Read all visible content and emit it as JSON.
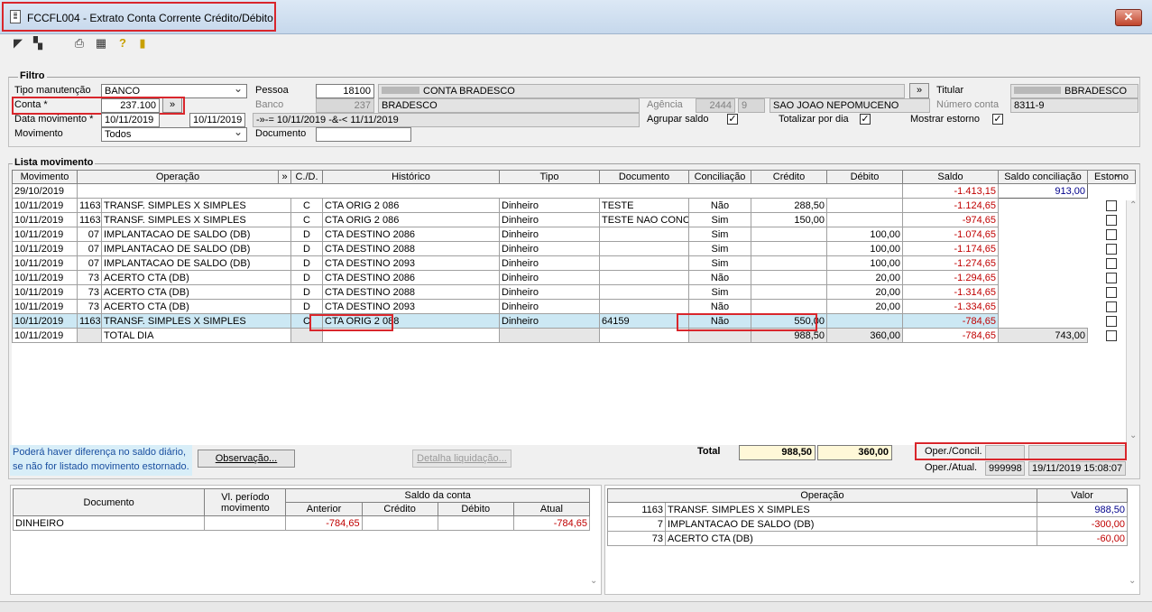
{
  "window": {
    "title": "FCCFL004 - Extrato Conta Corrente Crédito/Débito",
    "close": "✕"
  },
  "toolbar": {
    "icons": [
      "back-icon",
      "forward-icon",
      "print-icon",
      "grid-icon",
      "help-icon",
      "exit-icon"
    ]
  },
  "filtro": {
    "title": "Filtro",
    "tipo_manutencao_label": "Tipo manutenção",
    "tipo_manutencao": "BANCO",
    "conta_label": "Conta *",
    "conta": "237.100",
    "conta_btn": "»",
    "data_mov_label": "Data movimento *",
    "data_ini": "10/11/2019",
    "data_fim": "10/11/2019",
    "movimento_label": "Movimento",
    "movimento": "Todos",
    "pessoa_label": "Pessoa",
    "pessoa_code": "18100",
    "pessoa_name": "CONTA BRADESCO",
    "pessoa_btn": "»",
    "banco_label": "Banco",
    "banco_code": "237",
    "banco_name": "BRADESCO",
    "expr": "-»-= 10/11/2019 -&-< 11/11/2019",
    "documento_label": "Documento",
    "documento": "",
    "titular_label": "Titular",
    "titular": "BBRADESCO",
    "agencia_label": "Agência",
    "agencia": "2444",
    "agencia_dv": "9",
    "agencia_name": "SAO JOAO NEPOMUCENO",
    "numero_conta_label": "Número conta",
    "numero_conta": "8311-9",
    "agrupar_label": "Agrupar saldo",
    "totalizar_label": "Totalizar por dia",
    "mostrar_label": "Mostrar estorno",
    "check_mark": "✓"
  },
  "lista": {
    "title": "Lista movimento",
    "headers": {
      "movimento": "Movimento",
      "operacao": "Operação",
      "more": "»",
      "cd": "C./D.",
      "historico": "Histórico",
      "tipo": "Tipo",
      "documento": "Documento",
      "conciliacao": "Conciliação",
      "credito": "Crédito",
      "debito": "Débito",
      "saldo": "Saldo",
      "saldo_conc": "Saldo conciliação",
      "estorno": "Estorno"
    },
    "first_row": {
      "date": "29/10/2019",
      "saldo": "-1.413,15",
      "saldo_conc": "913,00"
    },
    "rows": [
      {
        "date": "10/11/2019",
        "op_code": "1163",
        "op": "TRANSF. SIMPLES X SIMPLES",
        "cd": "C",
        "hist": "CTA ORIG  2 086",
        "tipo": "Dinheiro",
        "doc": "TESTE",
        "conc": "Não",
        "cred": "288,50",
        "deb": "",
        "saldo": "-1.124,65"
      },
      {
        "date": "10/11/2019",
        "op_code": "1163",
        "op": "TRANSF. SIMPLES X SIMPLES",
        "cd": "C",
        "hist": "CTA ORIG  2 086",
        "tipo": "Dinheiro",
        "doc": "TESTE NAO CONCI",
        "conc": "Sim",
        "cred": "150,00",
        "deb": "",
        "saldo": "-974,65"
      },
      {
        "date": "10/11/2019",
        "op_code": "07",
        "op": "IMPLANTACAO DE SALDO (DB)",
        "cd": "D",
        "hist": "CTA DESTINO  2086",
        "tipo": "Dinheiro",
        "doc": "",
        "conc": "Sim",
        "cred": "",
        "deb": "100,00",
        "saldo": "-1.074,65"
      },
      {
        "date": "10/11/2019",
        "op_code": "07",
        "op": "IMPLANTACAO DE SALDO (DB)",
        "cd": "D",
        "hist": "CTA DESTINO  2088",
        "tipo": "Dinheiro",
        "doc": "",
        "conc": "Sim",
        "cred": "",
        "deb": "100,00",
        "saldo": "-1.174,65"
      },
      {
        "date": "10/11/2019",
        "op_code": "07",
        "op": "IMPLANTACAO DE SALDO (DB)",
        "cd": "D",
        "hist": "CTA DESTINO  2093",
        "tipo": "Dinheiro",
        "doc": "",
        "conc": "Sim",
        "cred": "",
        "deb": "100,00",
        "saldo": "-1.274,65"
      },
      {
        "date": "10/11/2019",
        "op_code": "73",
        "op": "ACERTO CTA (DB)",
        "cd": "D",
        "hist": "CTA DESTINO  2086",
        "tipo": "Dinheiro",
        "doc": "",
        "conc": "Não",
        "cred": "",
        "deb": "20,00",
        "saldo": "-1.294,65"
      },
      {
        "date": "10/11/2019",
        "op_code": "73",
        "op": "ACERTO CTA (DB)",
        "cd": "D",
        "hist": "CTA DESTINO  2088",
        "tipo": "Dinheiro",
        "doc": "",
        "conc": "Sim",
        "cred": "",
        "deb": "20,00",
        "saldo": "-1.314,65"
      },
      {
        "date": "10/11/2019",
        "op_code": "73",
        "op": "ACERTO CTA (DB)",
        "cd": "D",
        "hist": "CTA DESTINO  2093",
        "tipo": "Dinheiro",
        "doc": "",
        "conc": "Não",
        "cred": "",
        "deb": "20,00",
        "saldo": "-1.334,65"
      },
      {
        "date": "10/11/2019",
        "op_code": "1163",
        "op": "TRANSF. SIMPLES X SIMPLES",
        "cd": "C",
        "hist": "CTA ORIG  2 088",
        "tipo": "Dinheiro",
        "doc": "64159",
        "conc": "Não",
        "cred": "550,00",
        "deb": "",
        "saldo": "-784,65"
      }
    ],
    "total_row": {
      "date": "10/11/2019",
      "label": "TOTAL DIA",
      "cred": "988,50",
      "deb": "360,00",
      "saldo": "-784,65",
      "saldo_conc": "743,00"
    }
  },
  "footer": {
    "note1": "Poderá haver diferença no saldo diário,",
    "note2": "se não for listado movimento estornado.",
    "observacao_btn": "Observação...",
    "detalha_btn": "Detalha liquidação...",
    "total_label": "Total",
    "total_cred": "988,50",
    "total_deb": "360,00",
    "oper_concil_label": "Oper./Concil.",
    "oper_atual_label": "Oper./Atual.",
    "oper_atual_code": "999998",
    "oper_atual_date": "19/11/2019 15:08:07"
  },
  "saldo_table": {
    "h_documento": "Documento",
    "h_vl_periodo": "Vl. período movimento",
    "h_saldo_conta": "Saldo da conta",
    "h_anterior": "Anterior",
    "h_credito": "Crédito",
    "h_debito": "Débito",
    "h_atual": "Atual",
    "row": {
      "doc": "DINHEIRO",
      "vl": "",
      "anterior": "-784,65",
      "credito": "",
      "debito": "",
      "atual": "-784,65"
    }
  },
  "oper_table": {
    "h_operacao": "Operação",
    "h_valor": "Valor",
    "rows": [
      {
        "code": "1163",
        "name": "TRANSF. SIMPLES X SIMPLES",
        "valor": "988,50"
      },
      {
        "code": "7",
        "name": "IMPLANTACAO DE SALDO (DB)",
        "valor": "-300,00"
      },
      {
        "code": "73",
        "name": "ACERTO CTA (DB)",
        "valor": "-60,00"
      }
    ]
  }
}
